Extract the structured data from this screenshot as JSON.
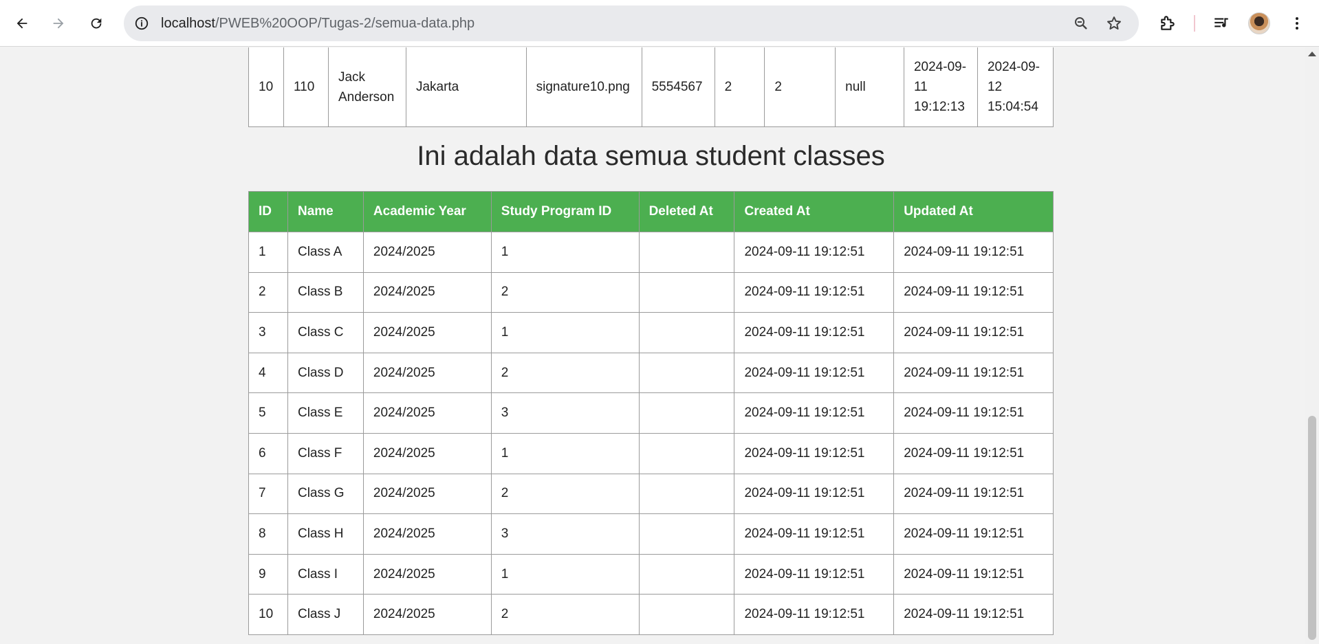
{
  "browser": {
    "url_host": "localhost",
    "url_path": "/PWEB%20OOP/Tugas-2/semua-data.php"
  },
  "previous_table_row": [
    "10",
    "110",
    "Jack Anderson",
    "Jakarta",
    "signature10.png",
    "5554567",
    "2",
    "2",
    "null",
    "2024-09-11 19:12:13",
    "2024-09-12 15:04:54"
  ],
  "student_classes": {
    "title": "Ini adalah data semua student classes",
    "columns": [
      "ID",
      "Name",
      "Academic Year",
      "Study Program ID",
      "Deleted At",
      "Created At",
      "Updated At"
    ],
    "rows": [
      [
        "1",
        "Class A",
        "2024/2025",
        "1",
        "",
        "2024-09-11 19:12:51",
        "2024-09-11 19:12:51"
      ],
      [
        "2",
        "Class B",
        "2024/2025",
        "2",
        "",
        "2024-09-11 19:12:51",
        "2024-09-11 19:12:51"
      ],
      [
        "3",
        "Class C",
        "2024/2025",
        "1",
        "",
        "2024-09-11 19:12:51",
        "2024-09-11 19:12:51"
      ],
      [
        "4",
        "Class D",
        "2024/2025",
        "2",
        "",
        "2024-09-11 19:12:51",
        "2024-09-11 19:12:51"
      ],
      [
        "5",
        "Class E",
        "2024/2025",
        "3",
        "",
        "2024-09-11 19:12:51",
        "2024-09-11 19:12:51"
      ],
      [
        "6",
        "Class F",
        "2024/2025",
        "1",
        "",
        "2024-09-11 19:12:51",
        "2024-09-11 19:12:51"
      ],
      [
        "7",
        "Class G",
        "2024/2025",
        "2",
        "",
        "2024-09-11 19:12:51",
        "2024-09-11 19:12:51"
      ],
      [
        "8",
        "Class H",
        "2024/2025",
        "3",
        "",
        "2024-09-11 19:12:51",
        "2024-09-11 19:12:51"
      ],
      [
        "9",
        "Class I",
        "2024/2025",
        "1",
        "",
        "2024-09-11 19:12:51",
        "2024-09-11 19:12:51"
      ],
      [
        "10",
        "Class J",
        "2024/2025",
        "2",
        "",
        "2024-09-11 19:12:51",
        "2024-09-11 19:12:51"
      ]
    ]
  },
  "icons": {
    "back": "back-arrow-icon",
    "forward": "forward-arrow-icon",
    "reload": "reload-icon",
    "site_info": "info-icon",
    "zoom": "zoom-icon",
    "bookmark": "star-icon",
    "extensions": "puzzle-icon",
    "media": "media-control-icon",
    "menu": "kebab-menu-icon"
  },
  "colors": {
    "table_header": "#4caf50",
    "page_background": "#f2f2f2"
  }
}
